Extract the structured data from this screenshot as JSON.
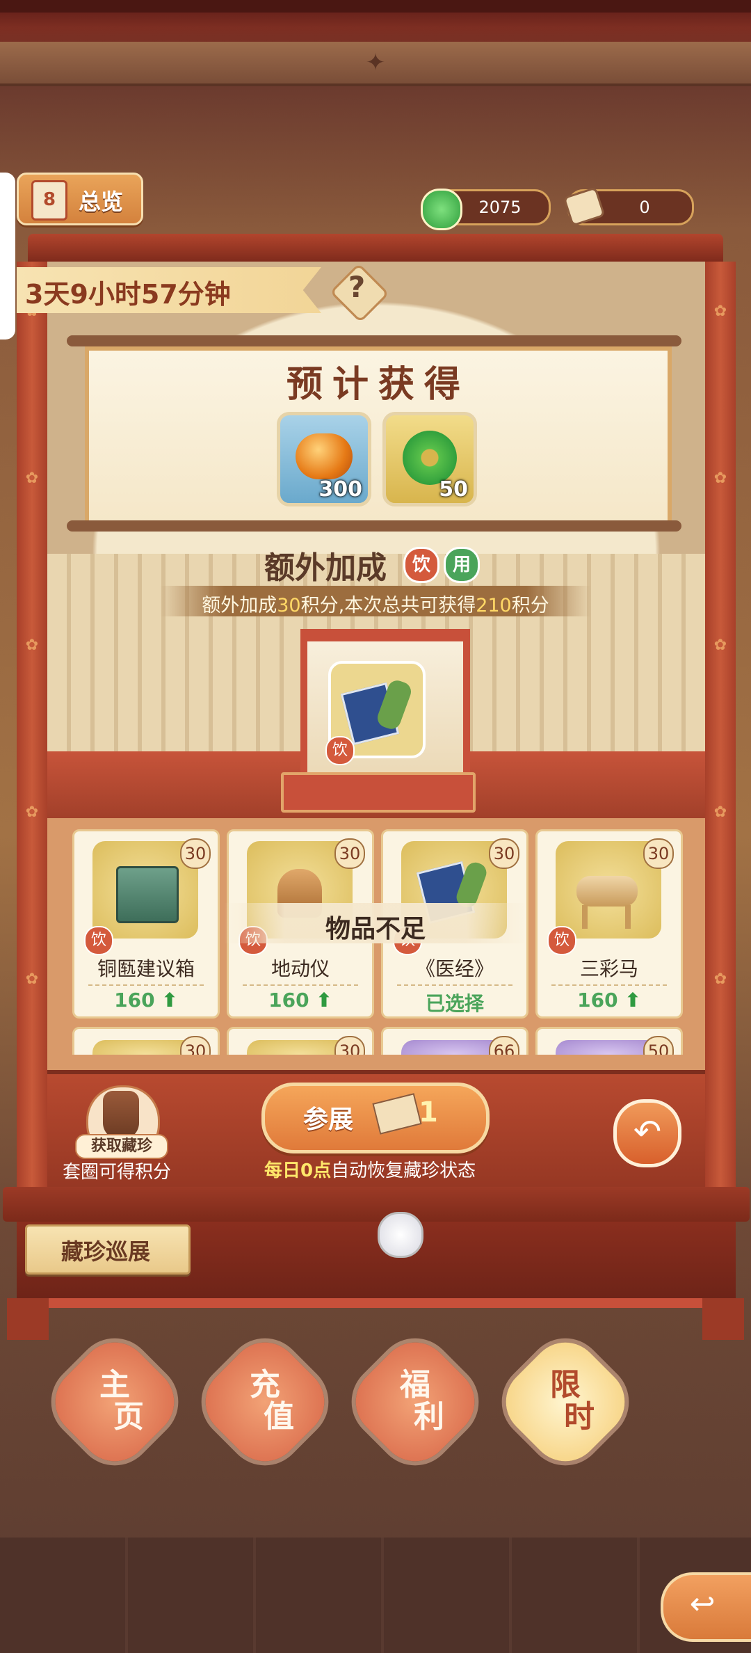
{
  "header": {
    "overview_label": "总览",
    "overview_icon_text": "8",
    "currency_1": {
      "value": "2075",
      "icon": "jade-coin-icon",
      "color": "#4cbf4c"
    },
    "currency_2": {
      "value": "0",
      "icon": "ticket-icon"
    }
  },
  "timer": {
    "remaining": "3天9小时57分钟",
    "help": "?"
  },
  "expected": {
    "title": "预计获得",
    "rewards": [
      {
        "icon": "amber-gem-icon",
        "amount": "300"
      },
      {
        "icon": "jade-disc-icon",
        "amount": "50"
      }
    ]
  },
  "bonus": {
    "title": "额外加成",
    "tags": [
      "饮",
      "用"
    ],
    "desc_prefix": "额外加成",
    "desc_points": "30",
    "desc_middle": "积分,本次总共可获得",
    "desc_total": "210",
    "desc_suffix": "积分"
  },
  "showcase": {
    "item_icon": "medical-book-icon",
    "badge": "饮"
  },
  "items": [
    {
      "name": "铜匦建议箱",
      "cost": "30",
      "badge": "饮",
      "points": "160",
      "icon": "bronze-box-icon",
      "selected": false
    },
    {
      "name": "地动仪",
      "cost": "30",
      "badge": "饮",
      "points": "160",
      "icon": "seismograph-icon",
      "selected": false
    },
    {
      "name": "《医经》",
      "cost": "30",
      "badge": "饮",
      "status": "已选择",
      "icon": "medical-book-icon",
      "selected": true
    },
    {
      "name": "三彩马",
      "cost": "30",
      "badge": "饮",
      "points": "160",
      "icon": "tricolor-horse-icon",
      "selected": false
    }
  ],
  "items_row2_costs": [
    "30",
    "30",
    "66",
    "50"
  ],
  "toast": "物品不足",
  "panel": {
    "get_label": "获取藏珍",
    "get_sub": "套圈可得积分",
    "join_label": "参展",
    "join_count": "1",
    "reset_hl": "每日0点",
    "reset_rest": "自动恢复藏珍状态"
  },
  "tour_label": "藏珍巡展",
  "tabs": [
    {
      "line1": "主",
      "line2": "页"
    },
    {
      "line1": "充",
      "line2": "值"
    },
    {
      "line1": "福",
      "line2": "利"
    },
    {
      "line1": "限",
      "line2": "时"
    }
  ]
}
